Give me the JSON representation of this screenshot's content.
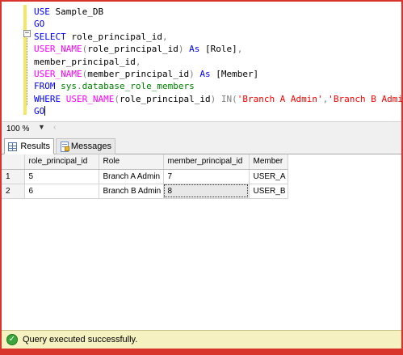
{
  "editor": {
    "lines": [
      {
        "parts": [
          {
            "t": "USE ",
            "c": "kw"
          },
          {
            "t": "Sample_DB",
            "c": "plain"
          }
        ]
      },
      {
        "parts": [
          {
            "t": "GO",
            "c": "kw"
          }
        ]
      },
      {
        "parts": [
          {
            "t": "SELECT ",
            "c": "kw"
          },
          {
            "t": "role_principal_id",
            "c": "plain"
          },
          {
            "t": ",",
            "c": "gray"
          }
        ]
      },
      {
        "parts": [
          {
            "t": "USER_NAME",
            "c": "fn"
          },
          {
            "t": "(",
            "c": "gray"
          },
          {
            "t": "role_principal_id",
            "c": "plain"
          },
          {
            "t": ") ",
            "c": "gray"
          },
          {
            "t": "As ",
            "c": "kw"
          },
          {
            "t": "[Role]",
            "c": "plain"
          },
          {
            "t": ",",
            "c": "gray"
          }
        ]
      },
      {
        "parts": [
          {
            "t": "member_principal_id",
            "c": "plain"
          },
          {
            "t": ",",
            "c": "gray"
          }
        ]
      },
      {
        "parts": [
          {
            "t": "USER_NAME",
            "c": "fn"
          },
          {
            "t": "(",
            "c": "gray"
          },
          {
            "t": "member_principal_id",
            "c": "plain"
          },
          {
            "t": ") ",
            "c": "gray"
          },
          {
            "t": "As ",
            "c": "kw"
          },
          {
            "t": "[Member]",
            "c": "plain"
          }
        ]
      },
      {
        "parts": [
          {
            "t": "FROM ",
            "c": "kw"
          },
          {
            "t": "sys",
            "c": "sys"
          },
          {
            "t": ".",
            "c": "gray"
          },
          {
            "t": "database_role_members",
            "c": "sys"
          }
        ]
      },
      {
        "parts": [
          {
            "t": "WHERE ",
            "c": "kw"
          },
          {
            "t": "USER_NAME",
            "c": "fn"
          },
          {
            "t": "(",
            "c": "gray"
          },
          {
            "t": "role_principal_id",
            "c": "plain"
          },
          {
            "t": ") ",
            "c": "gray"
          },
          {
            "t": "IN",
            "c": "gray"
          },
          {
            "t": "(",
            "c": "gray"
          },
          {
            "t": "'Branch A Admin'",
            "c": "str"
          },
          {
            "t": ",",
            "c": "gray"
          },
          {
            "t": "'Branch B Admin'",
            "c": "str"
          },
          {
            "t": ")",
            "c": "gray"
          }
        ]
      },
      {
        "parts": [
          {
            "t": "GO",
            "c": "kw"
          }
        ],
        "caret": true
      }
    ]
  },
  "zoom": {
    "value": "100 %"
  },
  "tabs": [
    {
      "label": "Results",
      "icon": "grid-icon",
      "active": true
    },
    {
      "label": "Messages",
      "icon": "messages-icon",
      "active": false
    }
  ],
  "results": {
    "columns": [
      "",
      "role_principal_id",
      "Role",
      "member_principal_id",
      "Member"
    ],
    "rows": [
      [
        "1",
        "5",
        "Branch A Admin",
        "7",
        "USER_A"
      ],
      [
        "2",
        "6",
        "Branch B Admin",
        "8",
        "USER_B"
      ]
    ],
    "selected_cell": {
      "row": 1,
      "col": 3
    }
  },
  "status": {
    "text": "Query executed successfully.",
    "icon": "check-icon",
    "color": "#f5f1c0"
  },
  "colors": {
    "keyword": "#0000ff",
    "function": "#ff00ff",
    "system": "#008000",
    "string": "#ff0000",
    "frame": "#d9342b"
  }
}
